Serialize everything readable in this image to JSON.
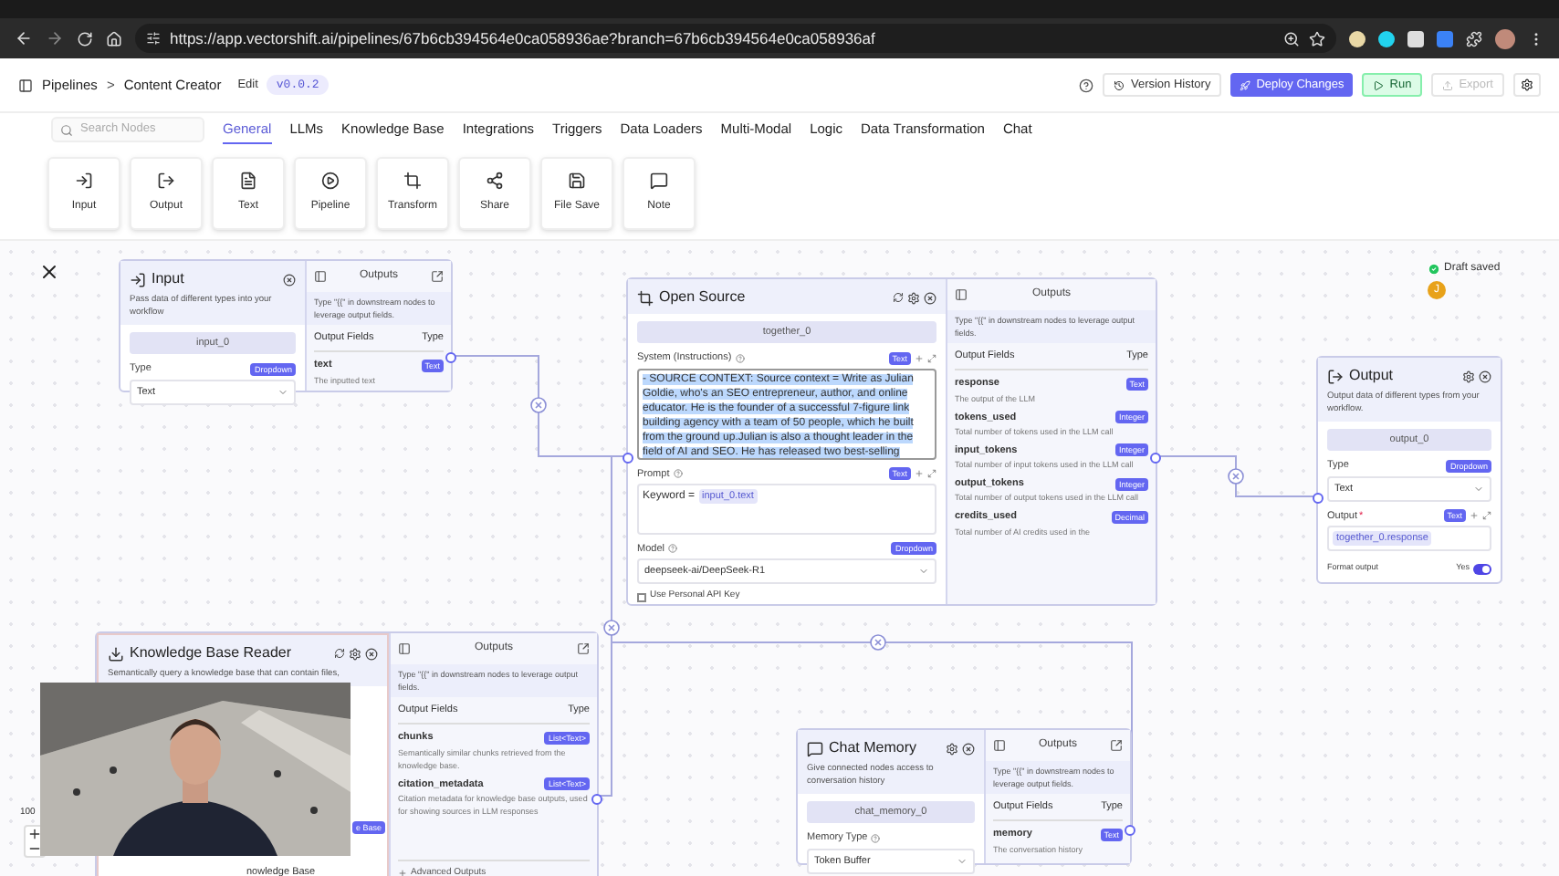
{
  "browser": {
    "url": "https://app.vectorshift.ai/pipelines/67b6cb394564e0ca058936ae?branch=67b6cb394564e0ca058936af"
  },
  "header": {
    "section": "Pipelines",
    "separator": ">",
    "title": "Content Creator",
    "edit": "Edit",
    "version": "v0.0.2",
    "actions": [
      {
        "label": "Version History",
        "kind": "outline",
        "disabled": false
      },
      {
        "label": "Deploy Changes",
        "kind": "primary",
        "disabled": false
      },
      {
        "label": "Run",
        "kind": "success",
        "disabled": false
      },
      {
        "label": "Export",
        "kind": "outline",
        "disabled": true
      }
    ]
  },
  "search": {
    "placeholder": "Search Nodes"
  },
  "tabs": [
    {
      "label": "General",
      "selected": true
    },
    {
      "label": "LLMs",
      "selected": false
    },
    {
      "label": "Knowledge Base",
      "selected": false
    },
    {
      "label": "Integrations",
      "selected": false
    },
    {
      "label": "Triggers",
      "selected": false
    },
    {
      "label": "Data Loaders",
      "selected": false
    },
    {
      "label": "Multi-Modal",
      "selected": false
    },
    {
      "label": "Logic",
      "selected": false
    },
    {
      "label": "Data Transformation",
      "selected": false
    },
    {
      "label": "Chat",
      "selected": false
    }
  ],
  "tools": [
    {
      "label": "Input",
      "kind": "input"
    },
    {
      "label": "Output",
      "kind": "output"
    },
    {
      "label": "Text",
      "kind": "text"
    },
    {
      "label": "Pipeline",
      "kind": "pipeline"
    },
    {
      "label": "Transform",
      "kind": "transform"
    },
    {
      "label": "Share",
      "kind": "share"
    },
    {
      "label": "File Save",
      "kind": "save"
    },
    {
      "label": "Note",
      "kind": "note"
    }
  ],
  "canvas": {
    "status": "Draft saved",
    "avatar": "J",
    "zoom": "100"
  },
  "nodes": [
    {
      "kind": "input",
      "title": "Input",
      "description": "Pass data of different types into your workflow",
      "name": "input_0",
      "type_label": "Type",
      "type_badge": "Dropdown",
      "type_value": "Text",
      "outputs": {
        "title": "Outputs",
        "hint": "Type \"{{\" in downstream nodes to leverage output fields.",
        "fields_header": "Output Fields",
        "type_header": "Type",
        "fields": [
          {
            "name": "text",
            "type": "Text",
            "description": "The inputted text"
          }
        ]
      }
    },
    {
      "kind": "llm",
      "title": "Open Source",
      "name": "together_0",
      "system_label": "System (Instructions)",
      "system_badge": "Text",
      "system_text": "- SOURCE CONTEXT: Source context = Write as Julian Goldie, who's an SEO entrepreneur, author, and online educator. He is the founder of a successful 7-figure link building agency with a team of 50 people, which he built from the ground up.Julian is also a thought leader in the field of AI and SEO. He has released two best-selling",
      "prompt_label": "Prompt",
      "prompt_badge": "Text",
      "prompt_prefix": "Keyword =",
      "prompt_var": "input_0.text",
      "model_label": "Model",
      "model_badge": "Dropdown",
      "model_value": "deepseek-ai/DeepSeek-R1",
      "api_key": {
        "label": "Use Personal API Key",
        "checked": false
      },
      "outputs": {
        "title": "Outputs",
        "hint": "Type \"{{\" in downstream nodes to leverage output fields.",
        "fields_header": "Output Fields",
        "type_header": "Type",
        "fields": [
          {
            "name": "response",
            "type": "Text",
            "description": "The output of the LLM"
          },
          {
            "name": "tokens_used",
            "type": "Integer",
            "description": "Total number of tokens used in the LLM call"
          },
          {
            "name": "input_tokens",
            "type": "Integer",
            "description": "Total number of input tokens used in the LLM call"
          },
          {
            "name": "output_tokens",
            "type": "Integer",
            "description": "Total number of output tokens used in the LLM call"
          },
          {
            "name": "credits_used",
            "type": "Decimal",
            "description": "Total number of AI credits used in the"
          }
        ]
      }
    },
    {
      "kind": "output",
      "title": "Output",
      "description": "Output data of different types from your workflow.",
      "name": "output_0",
      "type_label": "Type",
      "type_badge": "Dropdown",
      "type_value": "Text",
      "output_label": "Output",
      "required": "*",
      "output_badge": "Text",
      "output_var": "together_0.response",
      "format": {
        "label": "Format output",
        "value": "Yes",
        "on": true
      }
    },
    {
      "kind": "kb",
      "title": "Knowledge Base Reader",
      "description": "Semantically query a knowledge base that can contain files,",
      "badge_fragment": "e Base",
      "item_fragment": "nowledge Base",
      "outputs": {
        "title": "Outputs",
        "hint": "Type \"{{\" in downstream nodes to leverage output fields.",
        "fields_header": "Output Fields",
        "type_header": "Type",
        "fields": [
          {
            "name": "chunks",
            "type": "List<Text>",
            "description": "Semantically similar chunks retrieved from the knowledge base."
          },
          {
            "name": "citation_metadata",
            "type": "List<Text>",
            "description": "Citation metadata for knowledge base outputs, used for showing sources in LLM responses"
          }
        ],
        "advanced": "Advanced Outputs"
      }
    },
    {
      "kind": "memory",
      "title": "Chat Memory",
      "description": "Give connected nodes access to conversation history",
      "name": "chat_memory_0",
      "memory_label": "Memory Type",
      "memory_value": "Token Buffer",
      "outputs": {
        "title": "Outputs",
        "hint": "Type \"{{\" in downstream nodes to leverage output fields.",
        "fields_header": "Output Fields",
        "type_header": "Type",
        "fields": [
          {
            "name": "memory",
            "type": "Text",
            "description": "The conversation history"
          }
        ]
      }
    }
  ]
}
